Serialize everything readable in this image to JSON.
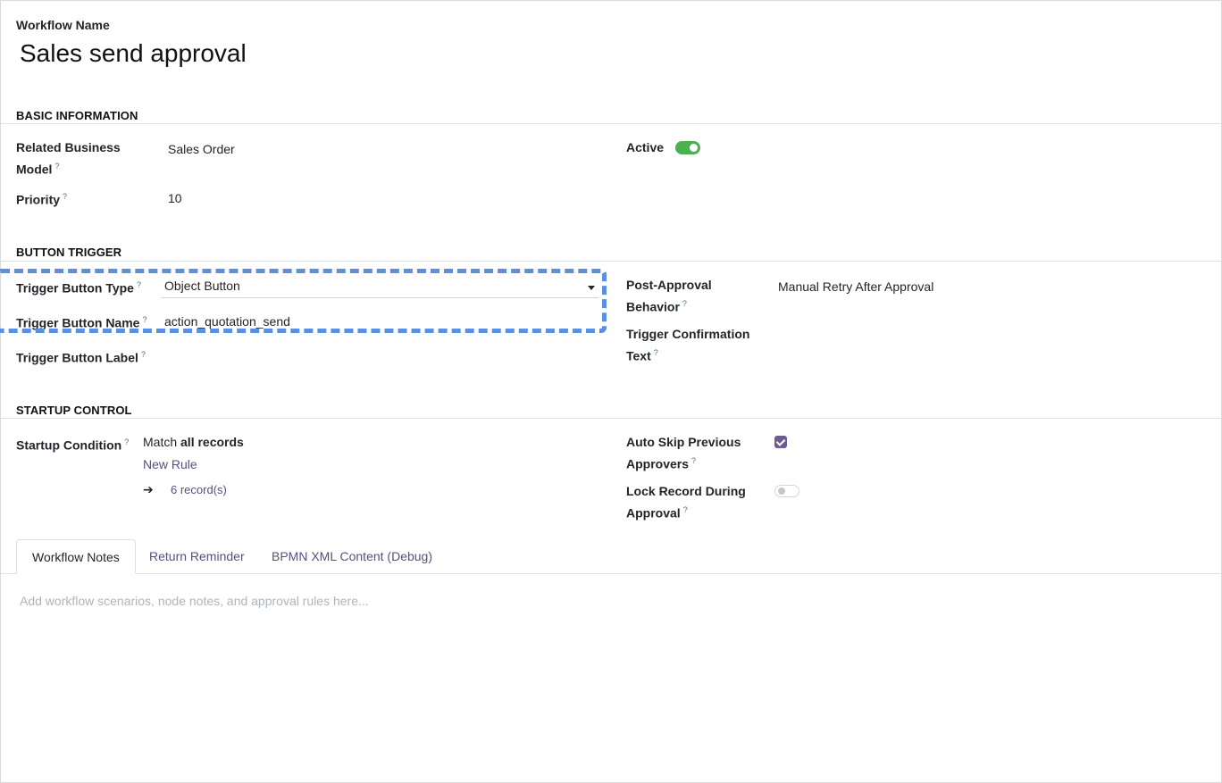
{
  "header": {
    "name_label": "Workflow Name",
    "name_value": "Sales send approval"
  },
  "sections": {
    "basic": "BASIC INFORMATION",
    "trigger": "BUTTON TRIGGER",
    "startup": "STARTUP CONTROL"
  },
  "basic": {
    "model_label_line1": "Related Business",
    "model_label_line2": "Model",
    "model_value": "Sales Order",
    "priority_label": "Priority",
    "priority_value": "10",
    "active_label": "Active",
    "active_state": true
  },
  "trigger": {
    "type_label": "Trigger Button Type",
    "type_value": "Object Button",
    "name_label": "Trigger Button Name",
    "name_value": "action_quotation_send",
    "button_label_label": "Trigger Button Label",
    "post_label_line1": "Post-Approval",
    "post_label_line2": "Behavior",
    "post_value": "Manual Retry After Approval",
    "confirm_label_line1": "Trigger Confirmation",
    "confirm_label_line2": "Text"
  },
  "startup": {
    "condition_label": "Startup Condition",
    "match_prefix": "Match",
    "match_bold": "all records",
    "new_rule": "New Rule",
    "records_arrow": "➔",
    "records_count": "6 record(s)",
    "auto_skip_line1": "Auto Skip Previous",
    "auto_skip_line2": "Approvers",
    "auto_skip_checked": true,
    "lock_line1": "Lock Record During",
    "lock_line2": "Approval",
    "lock_state": false
  },
  "help_mark": "?",
  "tabs": [
    {
      "label": "Workflow Notes",
      "active": true
    },
    {
      "label": "Return Reminder",
      "active": false
    },
    {
      "label": "BPMN XML Content (Debug)",
      "active": false
    }
  ],
  "notes": {
    "placeholder": "Add workflow scenarios, node notes, and approval rules here..."
  },
  "colors": {
    "toggle_on": "#4caf50",
    "checkbox": "#6f5a92",
    "link": "#5a4d7e",
    "highlight_dash": "#5b8fe3"
  }
}
